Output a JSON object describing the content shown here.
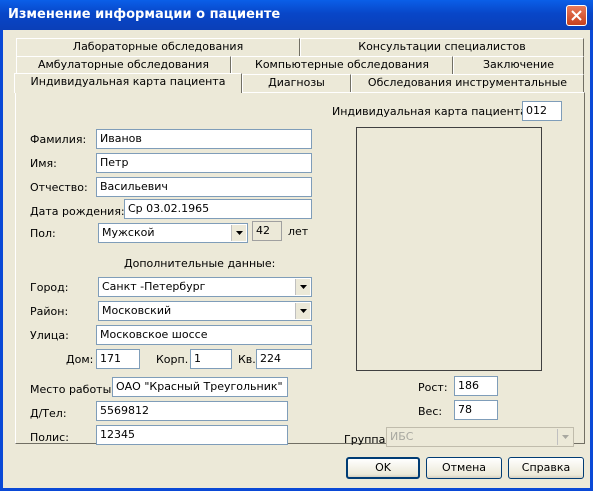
{
  "window": {
    "title": "Изменение информации о пациенте"
  },
  "tabs": {
    "row1": [
      {
        "label": "Лабораторные обследования"
      },
      {
        "label": "Консультации специалистов"
      }
    ],
    "row2": [
      {
        "label": "Амбулаторные обследования"
      },
      {
        "label": "Компьютерные обследования"
      },
      {
        "label": "Заключение"
      }
    ],
    "row3": [
      {
        "label": "Индивидуальная карта пациента",
        "active": true
      },
      {
        "label": "Диагнозы"
      },
      {
        "label": "Обследования инструментальные"
      }
    ]
  },
  "card": {
    "number_label": "Индивидуальная карта пациента №",
    "number": "012"
  },
  "form": {
    "surname_label": "Фамилия:",
    "surname": "Иванов",
    "name_label": "Имя:",
    "name": "Петр",
    "patronymic_label": "Отчество:",
    "patronymic": "Васильевич",
    "birthdate_label": "Дата рождения:",
    "birthdate": "Ср 03.02.1965",
    "sex_label": "Пол:",
    "sex": "Мужской",
    "age": "42",
    "age_unit": "лет",
    "extra_heading": "Дополнительные данные:",
    "city_label": "Город:",
    "city": "Санкт -Петербург",
    "district_label": "Район:",
    "district": "Московский",
    "street_label": "Улица:",
    "street": "Московское шоссе",
    "house_label": "Дом:",
    "house": "171",
    "building_label": "Корп.",
    "building": "1",
    "apartment_label": "Кв.",
    "apartment": "224",
    "work_label": "Место работы:",
    "work": "ОАО \"Красный Треугольник\"",
    "phone_label": "Д/Тел:",
    "phone": "5569812",
    "policy_label": "Полис:",
    "policy": "12345",
    "height_label": "Рост:",
    "height": "186",
    "weight_label": "Вес:",
    "weight": "78",
    "group_label": "Группа:",
    "group": "ИБС"
  },
  "buttons": {
    "ok": "OK",
    "cancel": "Отмена",
    "help": "Справка"
  },
  "colors": {
    "titlebar": "#0a4fd8",
    "window_bg": "#ece9d8",
    "field_border": "#7f9db9"
  }
}
